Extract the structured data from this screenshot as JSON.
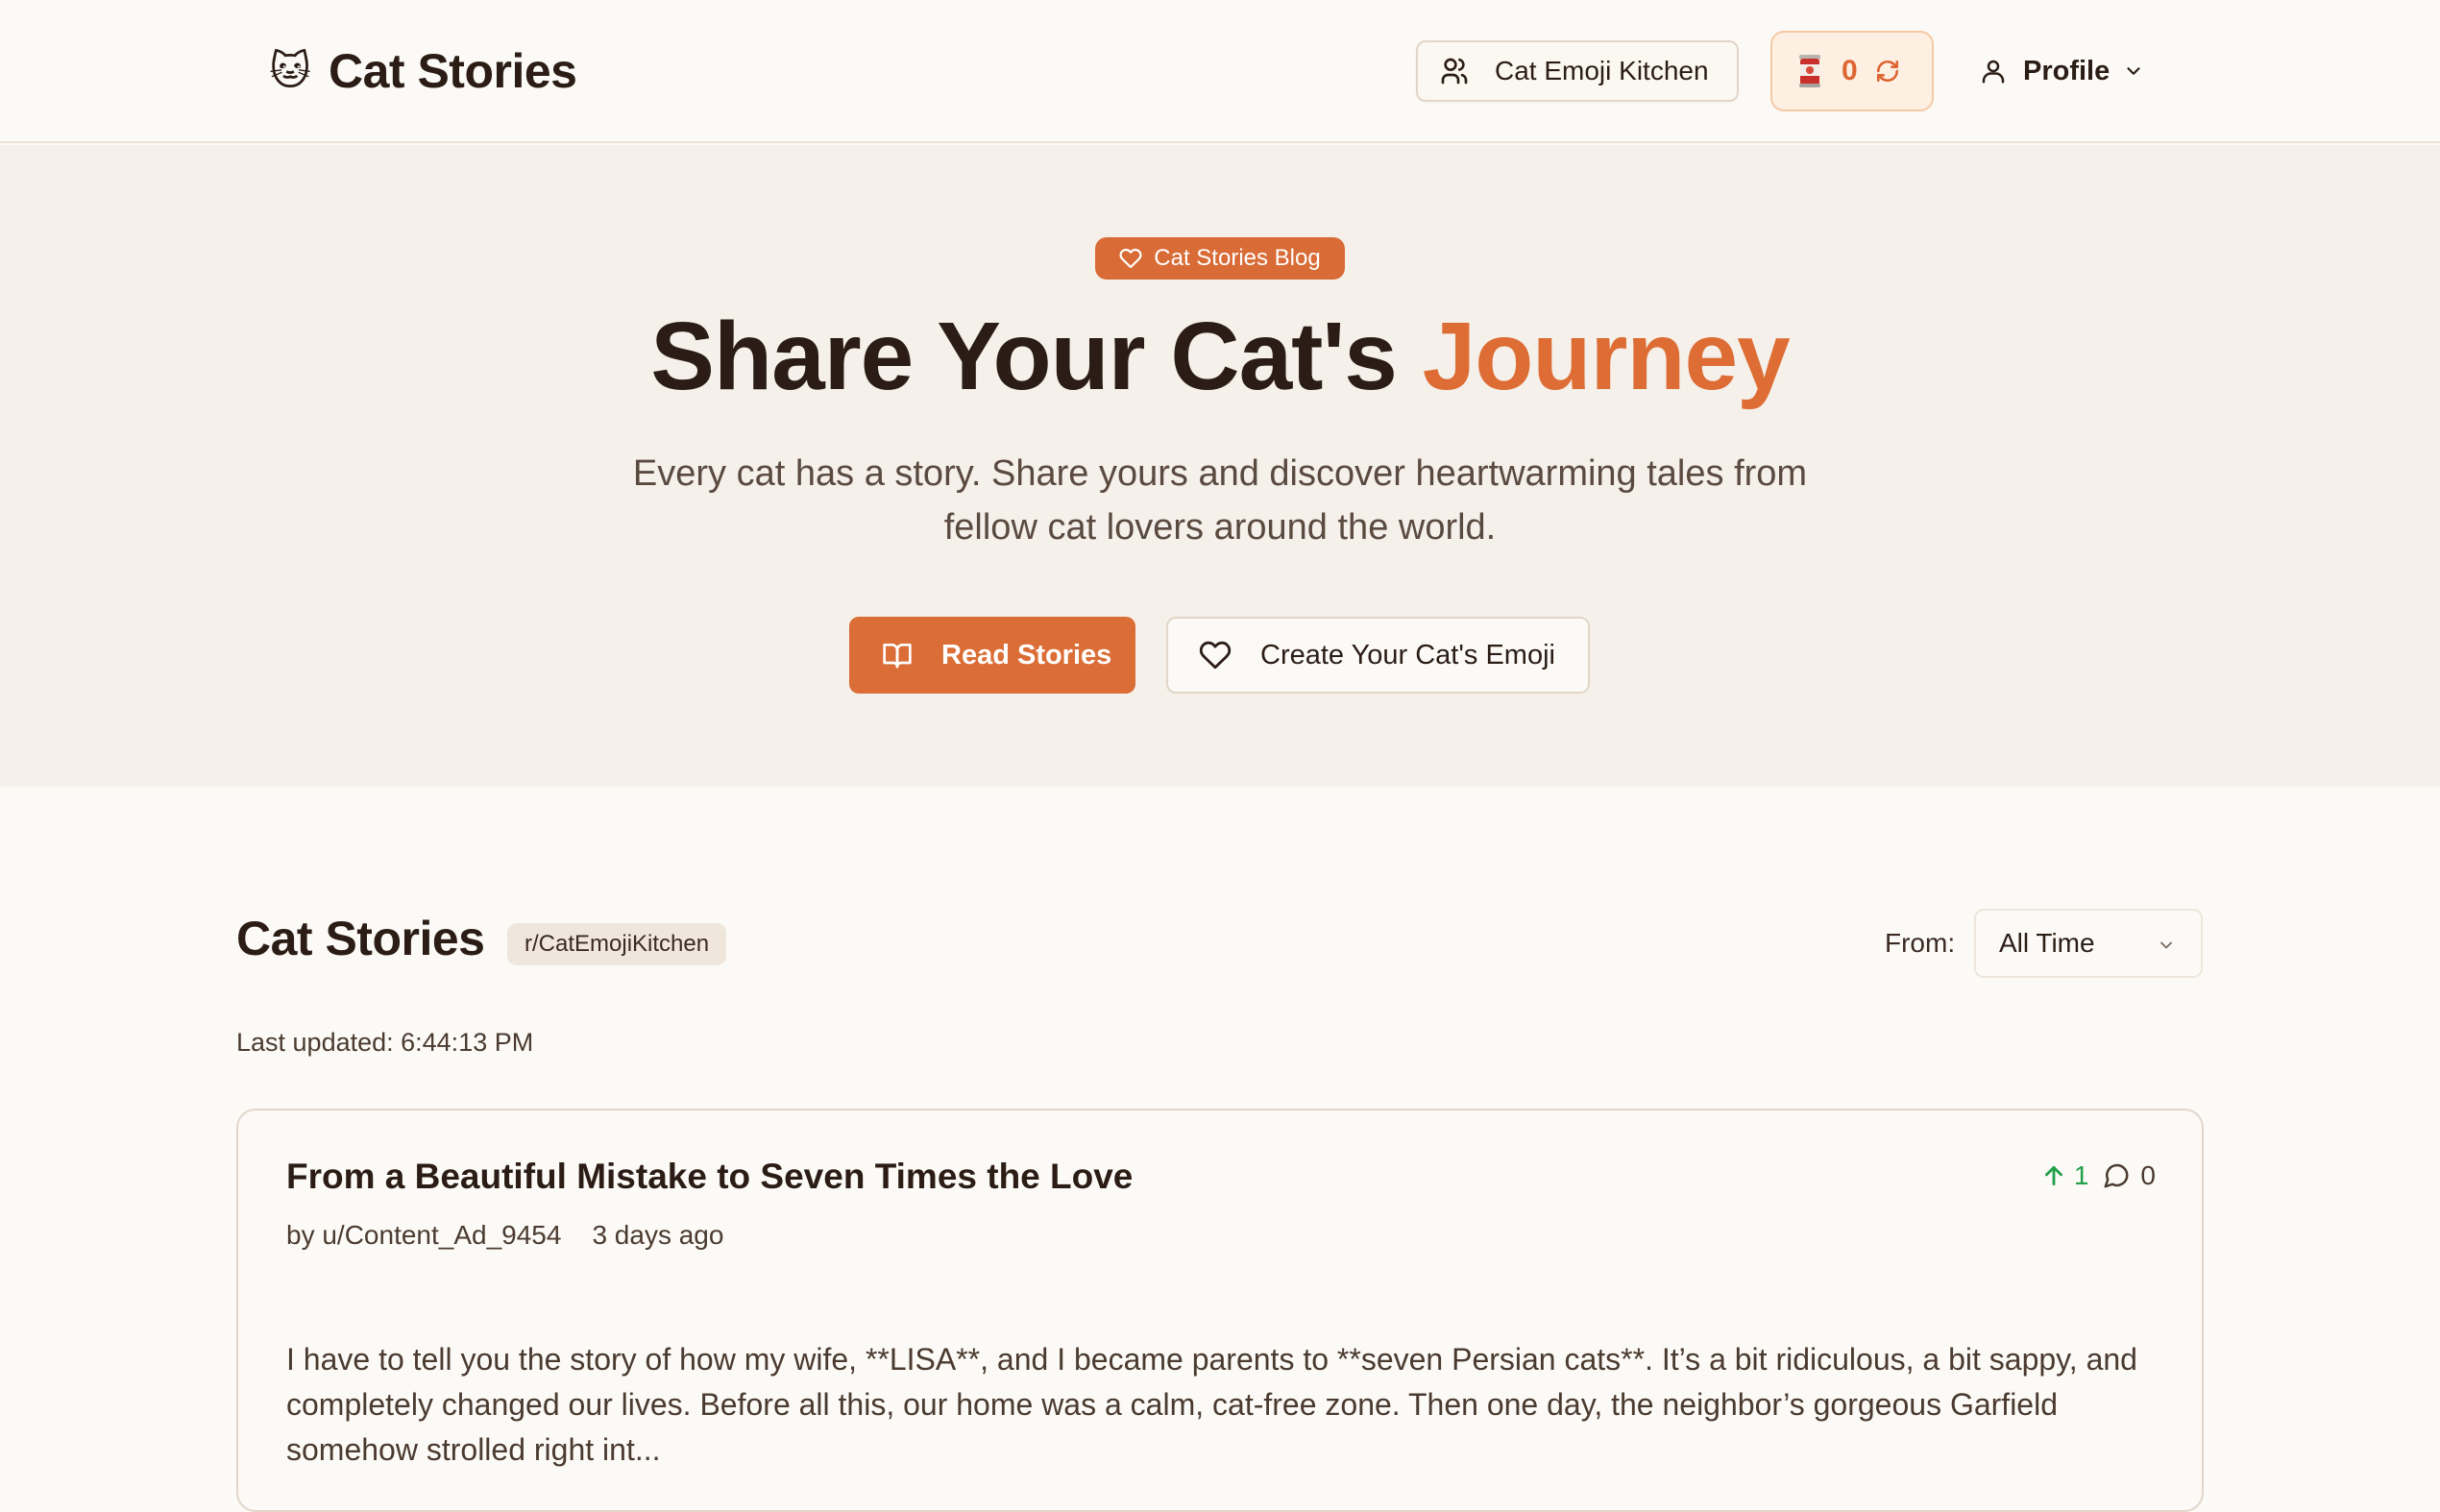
{
  "header": {
    "brand_emoji": "🐱",
    "brand_title": "Cat Stories",
    "kitchen_button_label": "Cat Emoji Kitchen",
    "counter_value": "0",
    "profile_label": "Profile"
  },
  "hero": {
    "badge": "Cat Stories Blog",
    "title_main": "Share Your Cat's ",
    "title_accent": "Journey",
    "subtitle": "Every cat has a story. Share yours and discover heartwarming tales from fellow cat lovers around the world.",
    "read_button": "Read Stories",
    "emoji_button": "Create Your Cat's Emoji"
  },
  "stories": {
    "title": "Cat Stories",
    "subreddit": "r/CatEmojiKitchen",
    "from_label": "From:",
    "from_selected": "All Time",
    "last_updated": "Last updated: 6:44:13 PM",
    "posts": [
      {
        "title": "From a Beautiful Mistake to Seven Times the Love",
        "author": "by u/Content_Ad_9454",
        "time": "3 days ago",
        "upvotes": "1",
        "comments": "0",
        "excerpt": "I have to tell you the story of how my wife, **LISA**, and I became parents to **seven Persian cats**. It’s a bit ridiculous, a bit sappy, and completely changed our lives. Before all this, our home was a calm, cat-free zone. Then one day, the neighbor’s gorgeous Garfield somehow strolled right int..."
      }
    ]
  },
  "colors": {
    "accent": "#dd6d34",
    "background": "#fcfaf6",
    "hero_background": "#f5f0ea",
    "upvote_green": "#22a04a"
  },
  "icons": {
    "brand": "cat-face-icon",
    "kitchen": "users-icon",
    "counter": "can-icon",
    "refresh": "refresh-icon",
    "profile": "user-icon",
    "badge": "heart-icon",
    "read": "book-open-icon",
    "emoji": "heart-icon",
    "select": "chevron-down-icon",
    "upvote": "arrow-up-icon",
    "comments": "message-circle-icon"
  }
}
